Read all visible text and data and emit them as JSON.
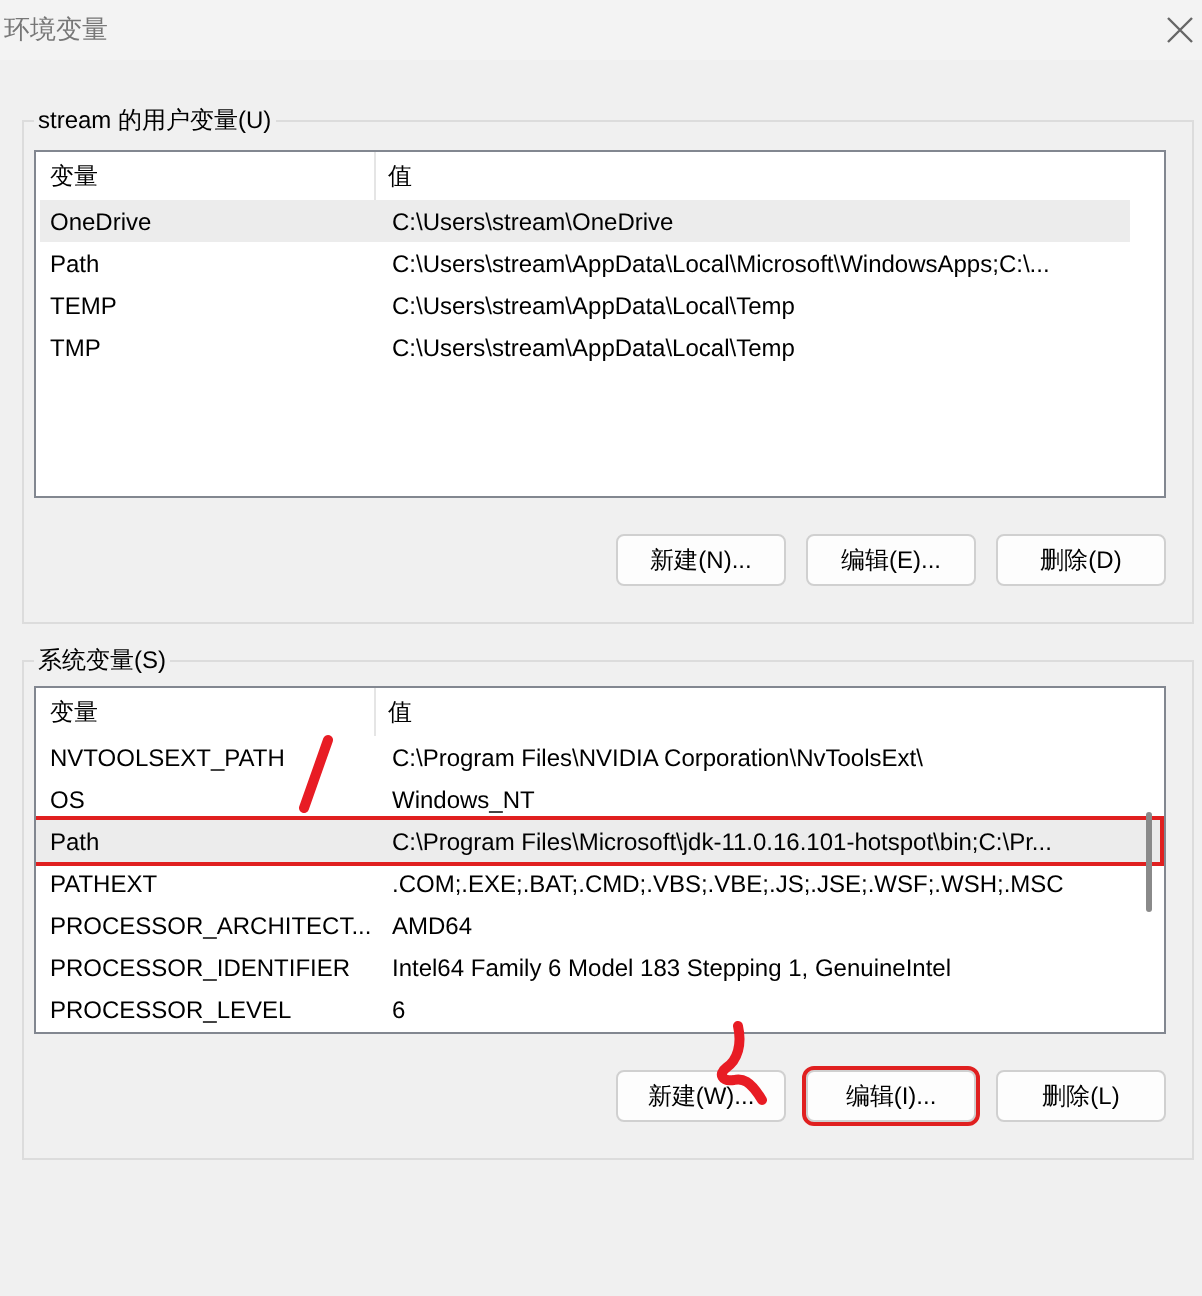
{
  "window": {
    "title": "环境变量"
  },
  "user_vars": {
    "title": "stream 的用户变量(U)",
    "columns": [
      "变量",
      "值"
    ],
    "rows": [
      {
        "name": "OneDrive",
        "value": "C:\\Users\\stream\\OneDrive",
        "selected": true,
        "highlighted": false
      },
      {
        "name": "Path",
        "value": "C:\\Users\\stream\\AppData\\Local\\Microsoft\\WindowsApps;C:\\...",
        "selected": false,
        "highlighted": false
      },
      {
        "name": "TEMP",
        "value": "C:\\Users\\stream\\AppData\\Local\\Temp",
        "selected": false,
        "highlighted": false
      },
      {
        "name": "TMP",
        "value": "C:\\Users\\stream\\AppData\\Local\\Temp",
        "selected": false,
        "highlighted": false
      }
    ],
    "buttons": [
      {
        "label": "新建(N)...",
        "highlighted": false
      },
      {
        "label": "编辑(E)...",
        "highlighted": false
      },
      {
        "label": "删除(D)",
        "highlighted": false
      }
    ]
  },
  "system_vars": {
    "title": "系统变量(S)",
    "columns": [
      "变量",
      "值"
    ],
    "rows": [
      {
        "name": "NVTOOLSEXT_PATH",
        "value": "C:\\Program Files\\NVIDIA Corporation\\NvToolsExt\\",
        "selected": false,
        "highlighted": false
      },
      {
        "name": "OS",
        "value": "Windows_NT",
        "selected": false,
        "highlighted": false
      },
      {
        "name": "Path",
        "value": "C:\\Program Files\\Microsoft\\jdk-11.0.16.101-hotspot\\bin;C:\\Pr...",
        "selected": true,
        "highlighted": true
      },
      {
        "name": "PATHEXT",
        "value": ".COM;.EXE;.BAT;.CMD;.VBS;.VBE;.JS;.JSE;.WSF;.WSH;.MSC",
        "selected": false,
        "highlighted": false
      },
      {
        "name": "PROCESSOR_ARCHITECT...",
        "value": "AMD64",
        "selected": false,
        "highlighted": false
      },
      {
        "name": "PROCESSOR_IDENTIFIER",
        "value": "Intel64 Family 6 Model 183 Stepping 1, GenuineIntel",
        "selected": false,
        "highlighted": false
      },
      {
        "name": "PROCESSOR_LEVEL",
        "value": "6",
        "selected": false,
        "highlighted": false
      }
    ],
    "buttons": [
      {
        "label": "新建(W)...",
        "highlighted": false
      },
      {
        "label": "编辑(I)...",
        "highlighted": true
      },
      {
        "label": "删除(L)",
        "highlighted": false
      }
    ]
  }
}
